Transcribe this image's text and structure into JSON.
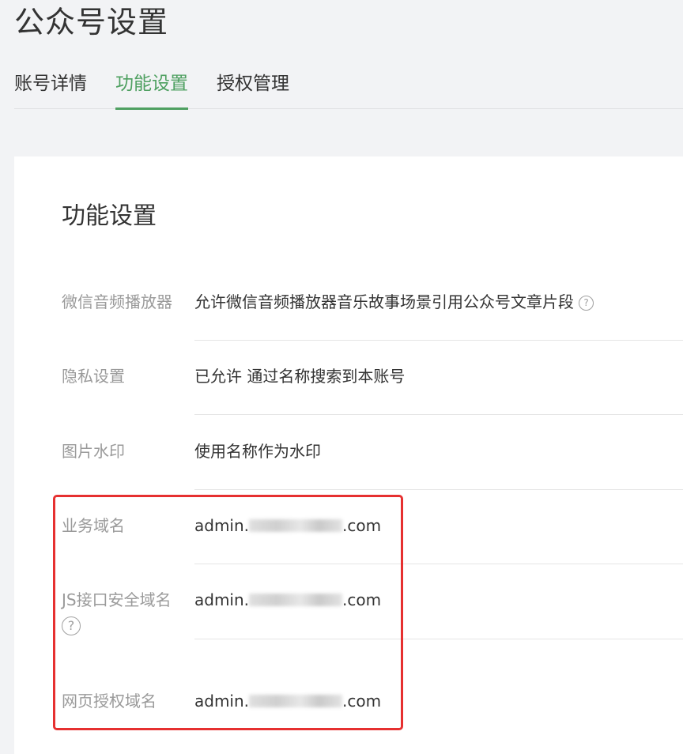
{
  "page": {
    "title": "公众号设置"
  },
  "tabs": [
    {
      "label": "账号详情",
      "active": false
    },
    {
      "label": "功能设置",
      "active": true
    },
    {
      "label": "授权管理",
      "active": false
    }
  ],
  "card": {
    "title": "功能设置",
    "rows": [
      {
        "label": "微信音频播放器",
        "value": "允许微信音频播放器音乐故事场景引用公众号文章片段"
      },
      {
        "label": "隐私设置",
        "value": "已允许 通过名称搜索到本账号"
      },
      {
        "label": "图片水印",
        "value": "使用名称作为水印"
      },
      {
        "label": "业务域名",
        "value_prefix": "admin.",
        "value_suffix": ".com"
      },
      {
        "label": "JS接口安全域名",
        "value_prefix": "admin.",
        "value_suffix": ".com"
      },
      {
        "label": "网页授权域名",
        "value_prefix": "admin.",
        "value_suffix": ".com"
      }
    ]
  },
  "icons": {
    "help": "question-circle-icon"
  },
  "colors": {
    "accent": "#4fa061",
    "highlight": "#e63030"
  }
}
